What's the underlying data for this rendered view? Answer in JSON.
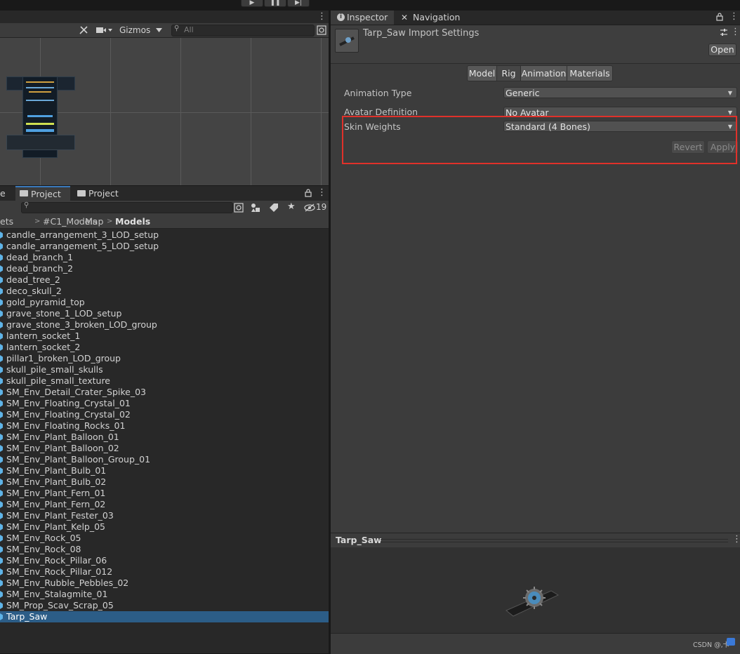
{
  "scene": {
    "gizmos_label": "Gizmos",
    "search_placeholder": "All"
  },
  "project": {
    "tabs": [
      {
        "label": "e"
      },
      {
        "label": "Project"
      },
      {
        "label": "Project"
      }
    ],
    "hidden_count": "19",
    "breadcrumb": [
      "ets",
      "#C1_Models",
      "Map",
      "Models"
    ],
    "files": [
      "candle_arrangement_3_LOD_setup",
      "candle_arrangement_5_LOD_setup",
      "dead_branch_1",
      "dead_branch_2",
      "dead_tree_2",
      "deco_skull_2",
      "gold_pyramid_top",
      "grave_stone_1_LOD_setup",
      "grave_stone_3_broken_LOD_group",
      "lantern_socket_1",
      "lantern_socket_2",
      "pillar1_broken_LOD_group",
      "skull_pile_small_skulls",
      "skull_pile_small_texture",
      "SM_Env_Detail_Crater_Spike_03",
      "SM_Env_Floating_Crystal_01",
      "SM_Env_Floating_Crystal_02",
      "SM_Env_Floating_Rocks_01",
      "SM_Env_Plant_Balloon_01",
      "SM_Env_Plant_Balloon_02",
      "SM_Env_Plant_Balloon_Group_01",
      "SM_Env_Plant_Bulb_01",
      "SM_Env_Plant_Bulb_02",
      "SM_Env_Plant_Fern_01",
      "SM_Env_Plant_Fern_02",
      "SM_Env_Plant_Fester_03",
      "SM_Env_Plant_Kelp_05",
      "SM_Env_Rock_05",
      "SM_Env_Rock_08",
      "SM_Env_Rock_Pillar_06",
      "SM_Env_Rock_Pillar_012",
      "SM_Env_Rubble_Pebbles_02",
      "SM_Env_Stalagmite_01",
      "SM_Prop_Scav_Scrap_05",
      "Tarp_Saw"
    ],
    "selected_file": "Tarp_Saw"
  },
  "inspector": {
    "tabs": [
      {
        "label": "Inspector"
      },
      {
        "label": "Navigation"
      }
    ],
    "title": "Tarp_Saw Import Settings",
    "open_label": "Open",
    "section_tabs": [
      "Model",
      "Rig",
      "Animation",
      "Materials"
    ],
    "active_section": "Rig",
    "fields": {
      "animation_type": {
        "label": "Animation Type",
        "value": "Generic"
      },
      "avatar_definition": {
        "label": "Avatar Definition",
        "value": "No Avatar"
      },
      "skin_weights": {
        "label": "Skin Weights",
        "value": "Standard (4 Bones)"
      }
    },
    "revert_label": "Revert",
    "apply_label": "Apply",
    "preview_title": "Tarp_Saw",
    "watermark": "CSDN @,卡"
  },
  "colors": {
    "highlight": "#e0312a",
    "selection": "#2c5d87",
    "active_tab_accent": "#3a79bb"
  }
}
